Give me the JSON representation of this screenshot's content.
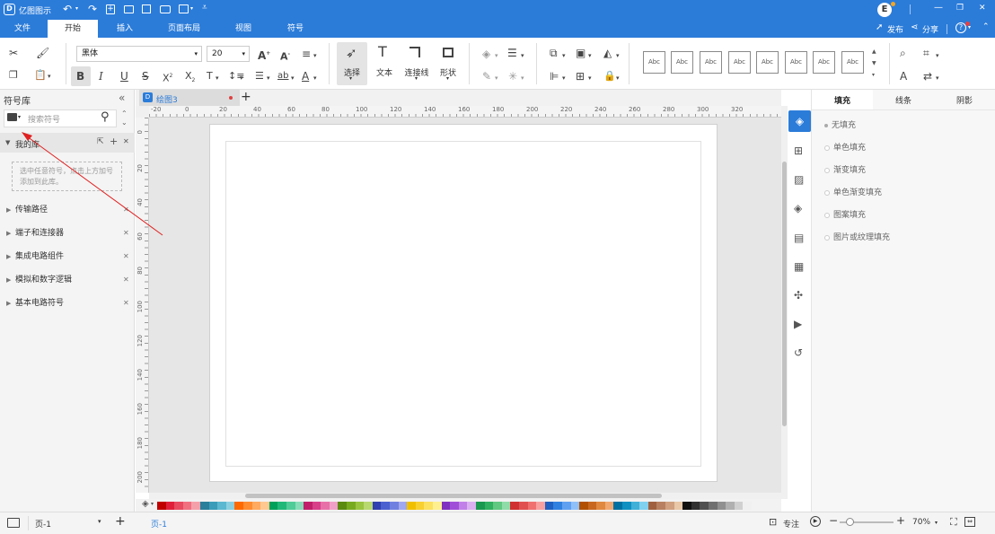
{
  "app": {
    "title": "亿图图示",
    "user_initial": "E"
  },
  "window_controls": {
    "minimize": "—",
    "maximize": "❐",
    "close": "✕"
  },
  "titlebar_icons": [
    "undo-icon",
    "redo-icon",
    "new-icon",
    "open-icon",
    "save-icon",
    "print-icon",
    "export-icon",
    "more-icon"
  ],
  "publish": {
    "label": "发布"
  },
  "share": {
    "label": "分享"
  },
  "help": {
    "label": "?"
  },
  "menu": {
    "items": [
      "文件",
      "开始",
      "插入",
      "页面布局",
      "视图",
      "符号"
    ],
    "active": "开始"
  },
  "ribbon": {
    "font_family": "黑体",
    "font_size": "20",
    "select_label": "选择",
    "text_label": "文本",
    "connector_label": "连接线",
    "shape_label": "形状",
    "style_samples": [
      "Abc",
      "Abc",
      "Abc",
      "Abc",
      "Abc",
      "Abc",
      "Abc",
      "Abc"
    ]
  },
  "left_panel": {
    "title": "符号库",
    "search_placeholder": "搜索符号",
    "my_library": "我的库",
    "my_library_hint": "选中任意符号，点击上方加号添加到此库。",
    "libraries": [
      "传输路径",
      "端子和连接器",
      "集成电路组件",
      "模拟和数字逻辑",
      "基本电路符号"
    ]
  },
  "doc_tab": {
    "name": "绘图3",
    "badge": "D"
  },
  "ruler": {
    "h_ticks": [
      "-20",
      "0",
      "20",
      "40",
      "60",
      "80",
      "100",
      "120",
      "140",
      "160",
      "180",
      "200",
      "220",
      "240",
      "260",
      "280",
      "300",
      "320"
    ],
    "v_ticks": [
      "0",
      "20",
      "40",
      "60",
      "80",
      "100",
      "120",
      "140",
      "160",
      "180",
      "200"
    ]
  },
  "right_panel": {
    "tabs": [
      "填充",
      "线条",
      "阴影"
    ],
    "active_tab": "填充",
    "fill_options": [
      "无填充",
      "单色填充",
      "渐变填充",
      "单色渐变填充",
      "图案填充",
      "图片或纹理填充"
    ]
  },
  "status": {
    "page_select": "页-1",
    "page_tab": "页-1",
    "focus_label": "专注",
    "zoom": "70%"
  },
  "colors": {
    "brand": "#2b7cd9",
    "annotation_arrow": "#e02020",
    "palette": [
      "#c00000",
      "#e0203a",
      "#e84a5f",
      "#f07080",
      "#f4a0aa",
      "#2a7f9a",
      "#3a9cb8",
      "#5cb8d0",
      "#8cd0e0",
      "#ff6a00",
      "#ff8c30",
      "#ffaa60",
      "#ffc890",
      "#00a05a",
      "#20b878",
      "#50cc98",
      "#88ddb8",
      "#c0206a",
      "#d8408a",
      "#e870a8",
      "#f0a0c8",
      "#5a8a10",
      "#78aa20",
      "#98c440",
      "#b8d870",
      "#3040b0",
      "#4a60d0",
      "#7080e0",
      "#a0a8f0",
      "#f0c000",
      "#f8d030",
      "#fce060",
      "#fef090",
      "#8030c0",
      "#a050d8",
      "#c080e8",
      "#dab0f0",
      "#1a9850",
      "#30b060",
      "#60c880",
      "#90dca8",
      "#d03030",
      "#e05050",
      "#f07070",
      "#f8a0a0",
      "#2060c0",
      "#3080e0",
      "#60a0f0",
      "#90c0f8",
      "#b05000",
      "#c86820",
      "#e08840",
      "#f0a870",
      "#0070a0",
      "#1090c0",
      "#40b0d8",
      "#80d0f0",
      "#a06040",
      "#b88060",
      "#d0a080",
      "#e8c8a8",
      "#101010",
      "#303030",
      "#505050",
      "#707070",
      "#909090",
      "#b0b0b0",
      "#d0d0d0",
      "#f0f0f0"
    ]
  }
}
